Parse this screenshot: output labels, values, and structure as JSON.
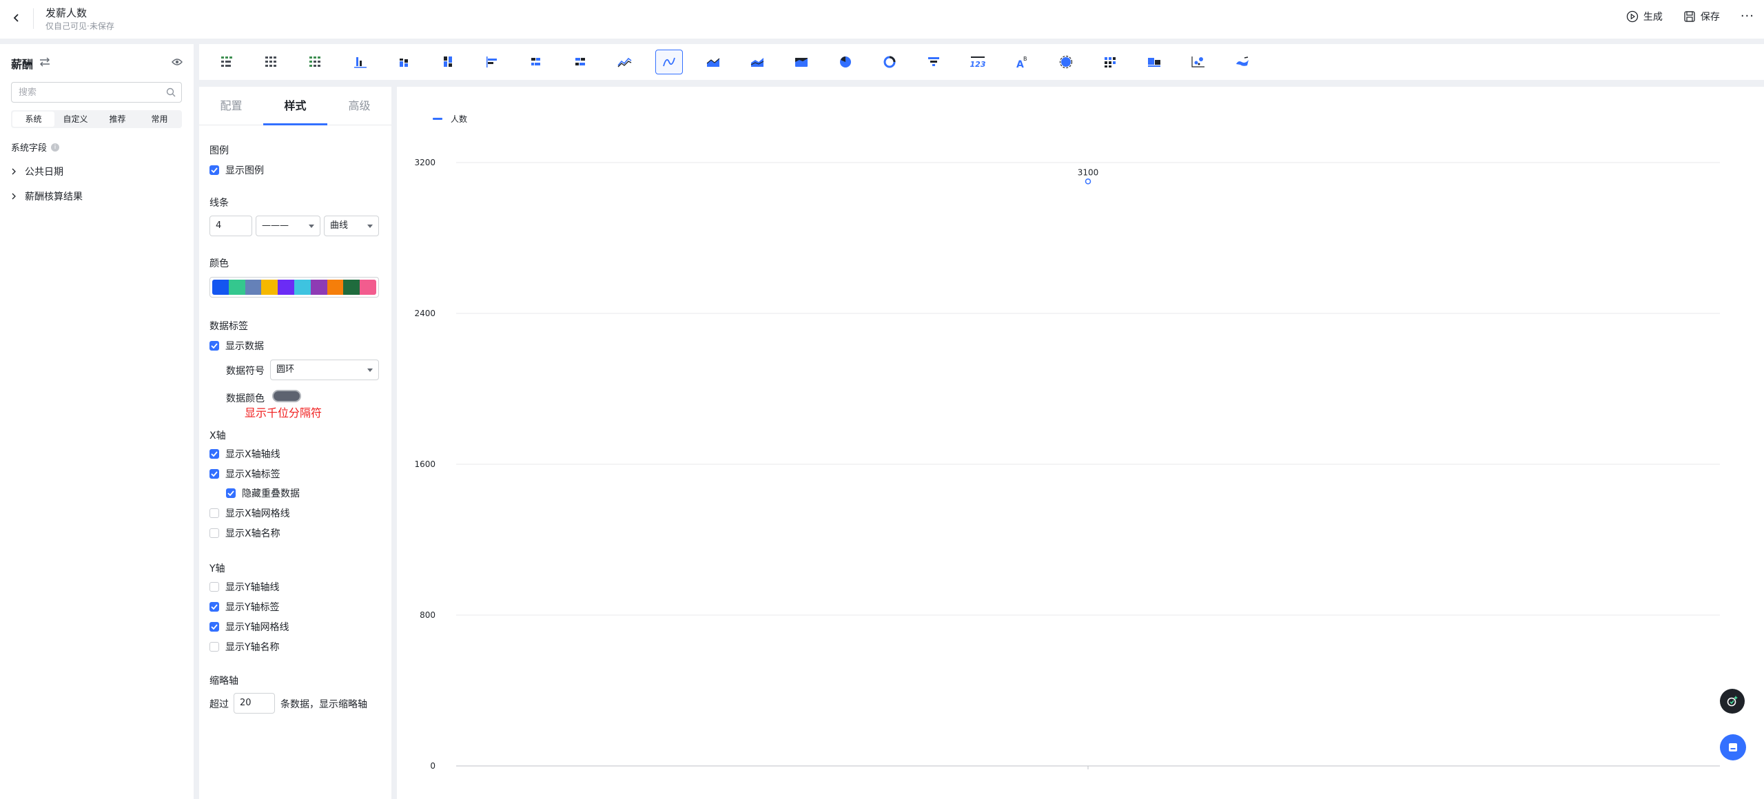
{
  "header": {
    "title": "发薪人数",
    "subtitle": "仅自己可见·未保存",
    "generate_label": "生成",
    "save_label": "保存"
  },
  "sidebar": {
    "datasource_name": "薪酬",
    "search": {
      "placeholder": "搜索",
      "value": ""
    },
    "field_tabs": [
      "系统",
      "自定义",
      "推荐",
      "常用"
    ],
    "active_field_tab": "系统",
    "section_label": "系统字段",
    "tree_items": [
      "公共日期",
      "薪酬核算结果"
    ]
  },
  "toolbar": {
    "chart_types": [
      "table-chart",
      "detail-table",
      "cross-table",
      "column-chart",
      "stacked-column",
      "percent-column",
      "bar-chart",
      "stacked-bar",
      "percent-bar",
      "line-chart",
      "curve-line-chart",
      "area-chart",
      "stacked-area",
      "percent-area",
      "pie-chart",
      "donut-chart",
      "funnel-chart",
      "kpi-number",
      "word-cloud",
      "gauge-chart",
      "matrix-chart",
      "combo-chart",
      "scatter-chart",
      "map-chart"
    ],
    "active": "curve-line-chart"
  },
  "panel": {
    "tabs": [
      "配置",
      "样式",
      "高级"
    ],
    "active_tab": "样式",
    "legend": {
      "title": "图例",
      "show_label": "显示图例",
      "show": true
    },
    "line": {
      "title": "线条",
      "width_value": "4",
      "style_value": "———",
      "shape_value": "曲线"
    },
    "color": {
      "title": "颜色",
      "palette": [
        "#1456f0",
        "#34c78e",
        "#6581b8",
        "#f5b800",
        "#6b2cf5",
        "#3ec3e0",
        "#8e3bb4",
        "#f57e0a",
        "#1f6b3d",
        "#f25c8e"
      ]
    },
    "data_label": {
      "title": "数据标签",
      "show_label": "显示数据",
      "show": true,
      "symbol_label": "数据符号",
      "symbol_value": "圆环",
      "color_label": "数据颜色",
      "color_value": "#5d6370",
      "thousands_label": "显示千位分隔符"
    },
    "x_axis": {
      "title": "X轴",
      "items": [
        {
          "label": "显示X轴轴线",
          "checked": true
        },
        {
          "label": "显示X轴标签",
          "checked": true
        },
        {
          "label": "隐藏重叠数据",
          "checked": true
        },
        {
          "label": "显示X轴网格线",
          "checked": false
        },
        {
          "label": "显示X轴名称",
          "checked": false
        }
      ]
    },
    "y_axis": {
      "title": "Y轴",
      "items": [
        {
          "label": "显示Y轴轴线",
          "checked": false
        },
        {
          "label": "显示Y轴标签",
          "checked": true
        },
        {
          "label": "显示Y轴网格线",
          "checked": true
        },
        {
          "label": "显示Y轴名称",
          "checked": false
        }
      ]
    },
    "thumbnail_axis": {
      "title": "缩略轴",
      "prefix": "超过",
      "value": "20",
      "suffix": "条数据，显示缩略轴"
    }
  },
  "chart_data": {
    "type": "line",
    "title": "",
    "xlabel": "",
    "ylabel": "",
    "categories": [
      ""
    ],
    "series": [
      {
        "name": "人数",
        "values": [
          3100
        ]
      }
    ],
    "data_labels": [
      "3100"
    ],
    "yticks": [
      "0",
      "800",
      "1600",
      "2400",
      "3200"
    ],
    "ylim": [
      0,
      3200
    ],
    "grid": "horizontal",
    "legend_position": "top-left",
    "series_color": "#3370ff"
  }
}
